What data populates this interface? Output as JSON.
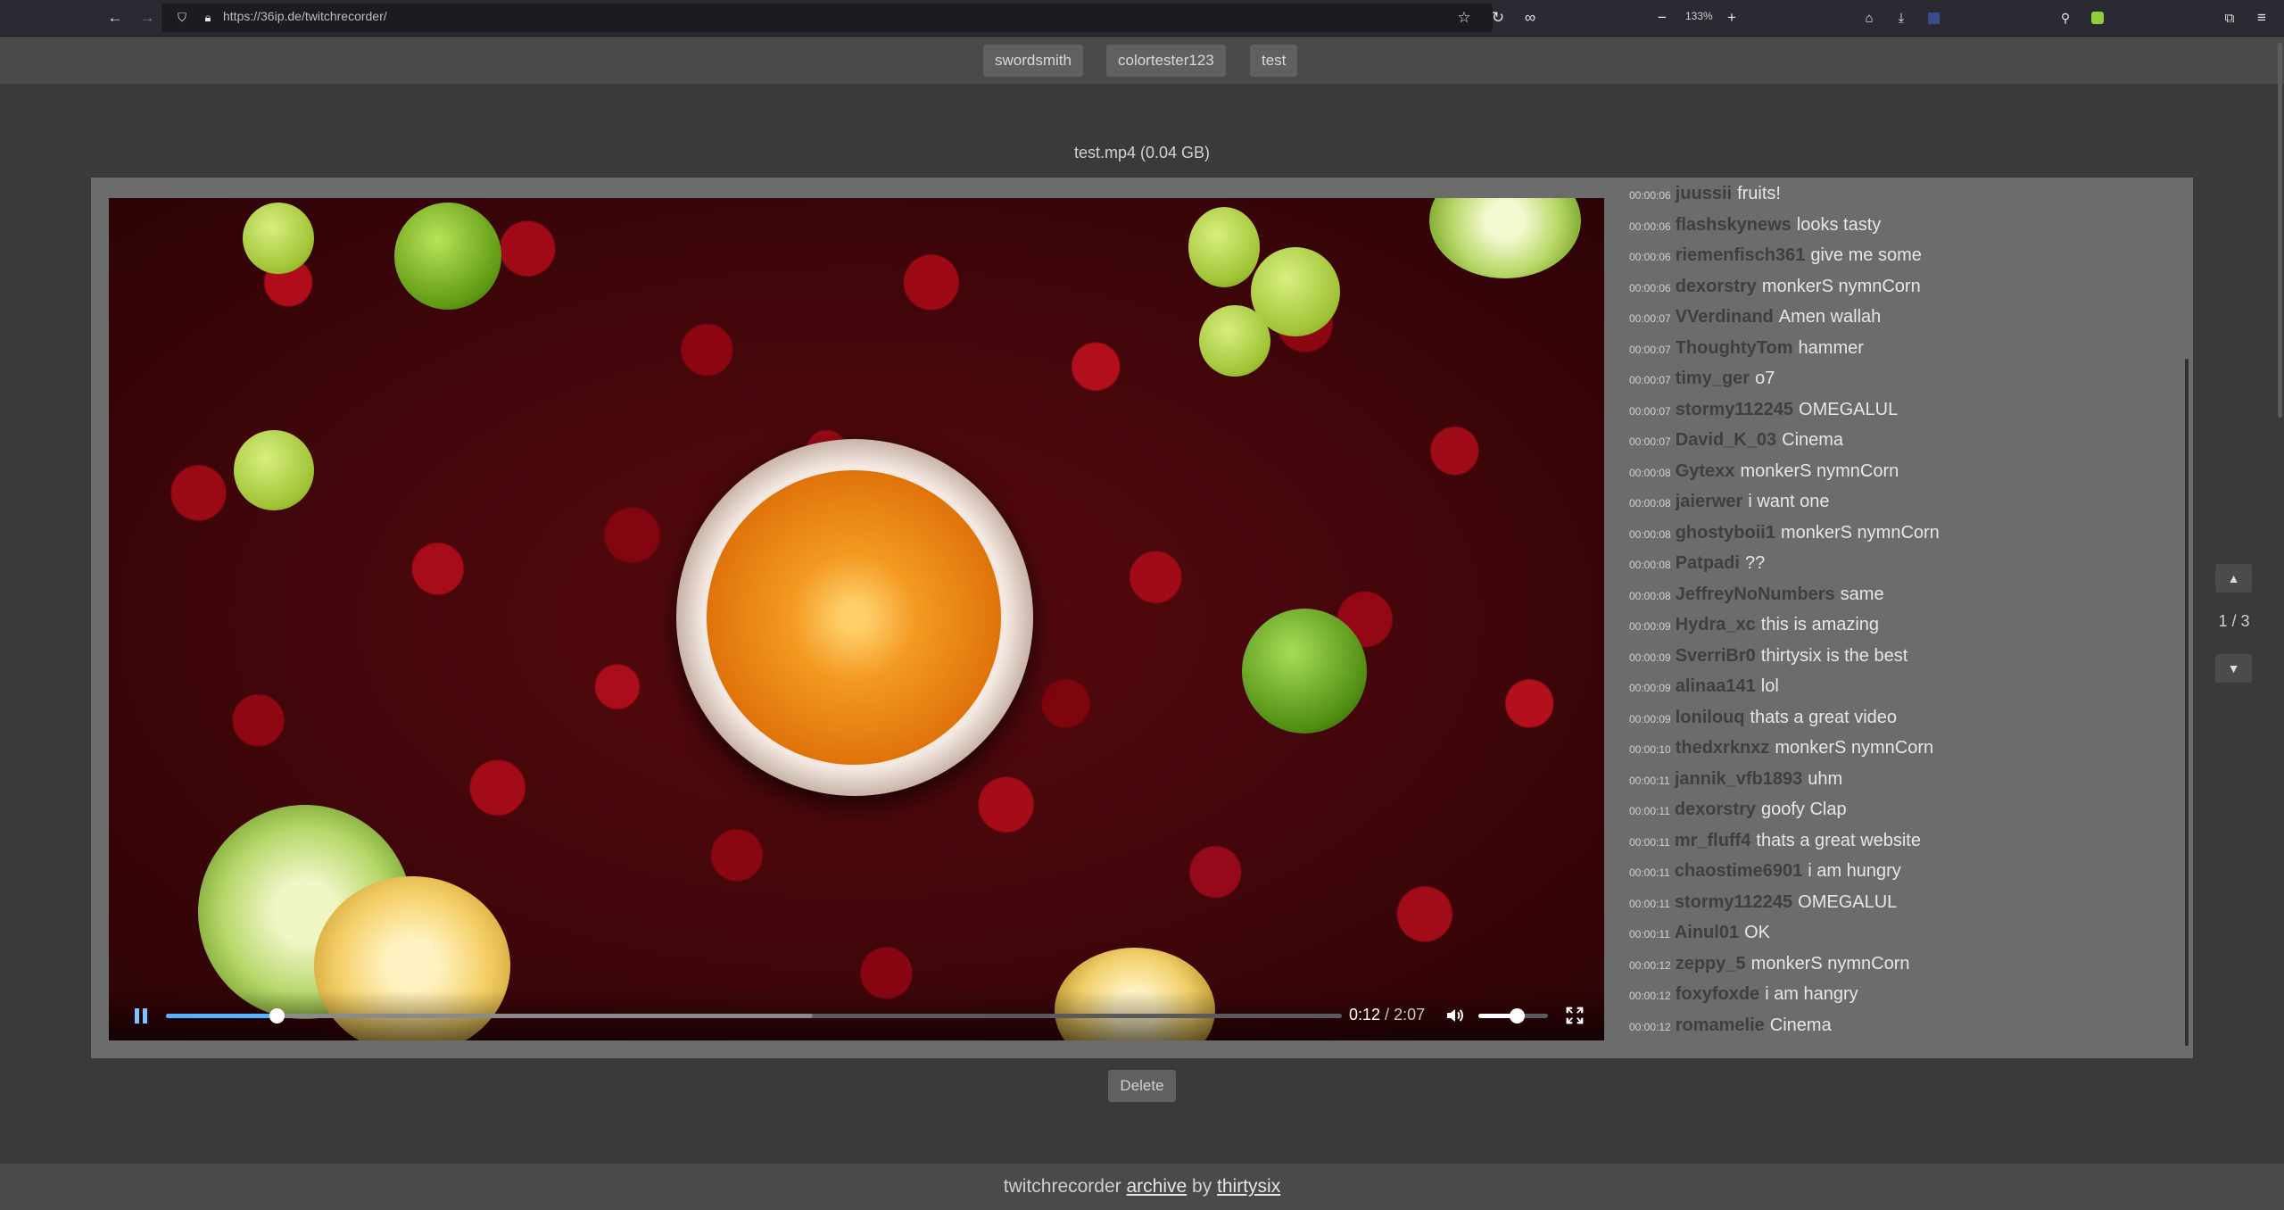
{
  "browser": {
    "url": "https://36ip.de/twitchrecorder/",
    "zoom": "133%"
  },
  "nav": {
    "buttons": [
      "swordsmith",
      "colortester123",
      "test"
    ]
  },
  "file": {
    "title": "test.mp4 (0.04 GB)"
  },
  "player": {
    "current_time": "0:12",
    "separator": " / ",
    "duration": "2:07",
    "progress_fraction": 0.094,
    "buffered_fraction": 0.55,
    "volume_fraction": 0.55
  },
  "chat": {
    "messages": [
      {
        "time": "00:00:06",
        "user": "juussii",
        "text": "fruits!"
      },
      {
        "time": "00:00:06",
        "user": "flashskynews",
        "text": "looks tasty"
      },
      {
        "time": "00:00:06",
        "user": "riemenfisch361",
        "text": "give me some"
      },
      {
        "time": "00:00:06",
        "user": "dexorstry",
        "text": "monkerS nymnCorn"
      },
      {
        "time": "00:00:07",
        "user": "VVerdinand",
        "text": "Amen wallah"
      },
      {
        "time": "00:00:07",
        "user": "ThoughtyTom",
        "text": "hammer"
      },
      {
        "time": "00:00:07",
        "user": "timy_ger",
        "text": "o7"
      },
      {
        "time": "00:00:07",
        "user": "stormy112245",
        "text": "OMEGALUL"
      },
      {
        "time": "00:00:07",
        "user": "David_K_03",
        "text": "Cinema"
      },
      {
        "time": "00:00:08",
        "user": "Gytexx",
        "text": "monkerS nymnCorn"
      },
      {
        "time": "00:00:08",
        "user": "jaierwer",
        "text": "i want one"
      },
      {
        "time": "00:00:08",
        "user": "ghostyboii1",
        "text": "monkerS nymnCorn"
      },
      {
        "time": "00:00:08",
        "user": "Patpadi",
        "text": "??"
      },
      {
        "time": "00:00:08",
        "user": "JeffreyNoNumbers",
        "text": "same"
      },
      {
        "time": "00:00:09",
        "user": "Hydra_xc",
        "text": "this is amazing"
      },
      {
        "time": "00:00:09",
        "user": "SverriBr0",
        "text": "thirtysix is the best"
      },
      {
        "time": "00:00:09",
        "user": "alinaa141",
        "text": "lol"
      },
      {
        "time": "00:00:09",
        "user": "lonilouq",
        "text": "thats a great video"
      },
      {
        "time": "00:00:10",
        "user": "thedxrknxz",
        "text": "monkerS nymnCorn"
      },
      {
        "time": "00:00:11",
        "user": "jannik_vfb1893",
        "text": "uhm"
      },
      {
        "time": "00:00:11",
        "user": "dexorstry",
        "text": "goofy Clap"
      },
      {
        "time": "00:00:11",
        "user": "mr_fluff4",
        "text": "thats a great website"
      },
      {
        "time": "00:00:11",
        "user": "chaostime6901",
        "text": "i am hungry"
      },
      {
        "time": "00:00:11",
        "user": "stormy112245",
        "text": "OMEGALUL"
      },
      {
        "time": "00:00:11",
        "user": "Ainul01",
        "text": "OK"
      },
      {
        "time": "00:00:12",
        "user": "zeppy_5",
        "text": "monkerS nymnCorn"
      },
      {
        "time": "00:00:12",
        "user": "foxyfoxde",
        "text": "i am hangry"
      },
      {
        "time": "00:00:12",
        "user": "romamelie",
        "text": "Cinema"
      }
    ]
  },
  "pager": {
    "label": "1 / 3",
    "up": "▲",
    "down": "▼"
  },
  "actions": {
    "delete_label": "Delete"
  },
  "footer": {
    "prefix": "twitchrecorder ",
    "archive_link": "archive",
    "by": " by ",
    "author_link": "thirtysix"
  }
}
